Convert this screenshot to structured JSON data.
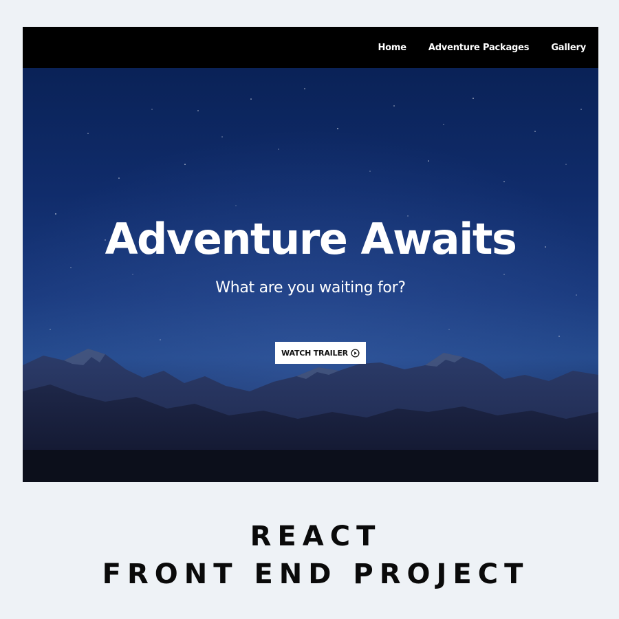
{
  "nav": {
    "items": [
      {
        "label": "Home"
      },
      {
        "label": "Adventure Packages"
      },
      {
        "label": "Gallery"
      }
    ]
  },
  "hero": {
    "title": "Adventure Awaits",
    "subtitle": "What are you waiting for?",
    "button_label": "WATCH TRAILER",
    "button_icon": "play-circle-icon"
  },
  "caption": {
    "line1": "REACT",
    "line2": "FRONT END PROJECT"
  },
  "colors": {
    "page_background": "#eef2f6",
    "navbar": "#000000",
    "sky": "#1a3a7e",
    "button": "#ffffff"
  }
}
